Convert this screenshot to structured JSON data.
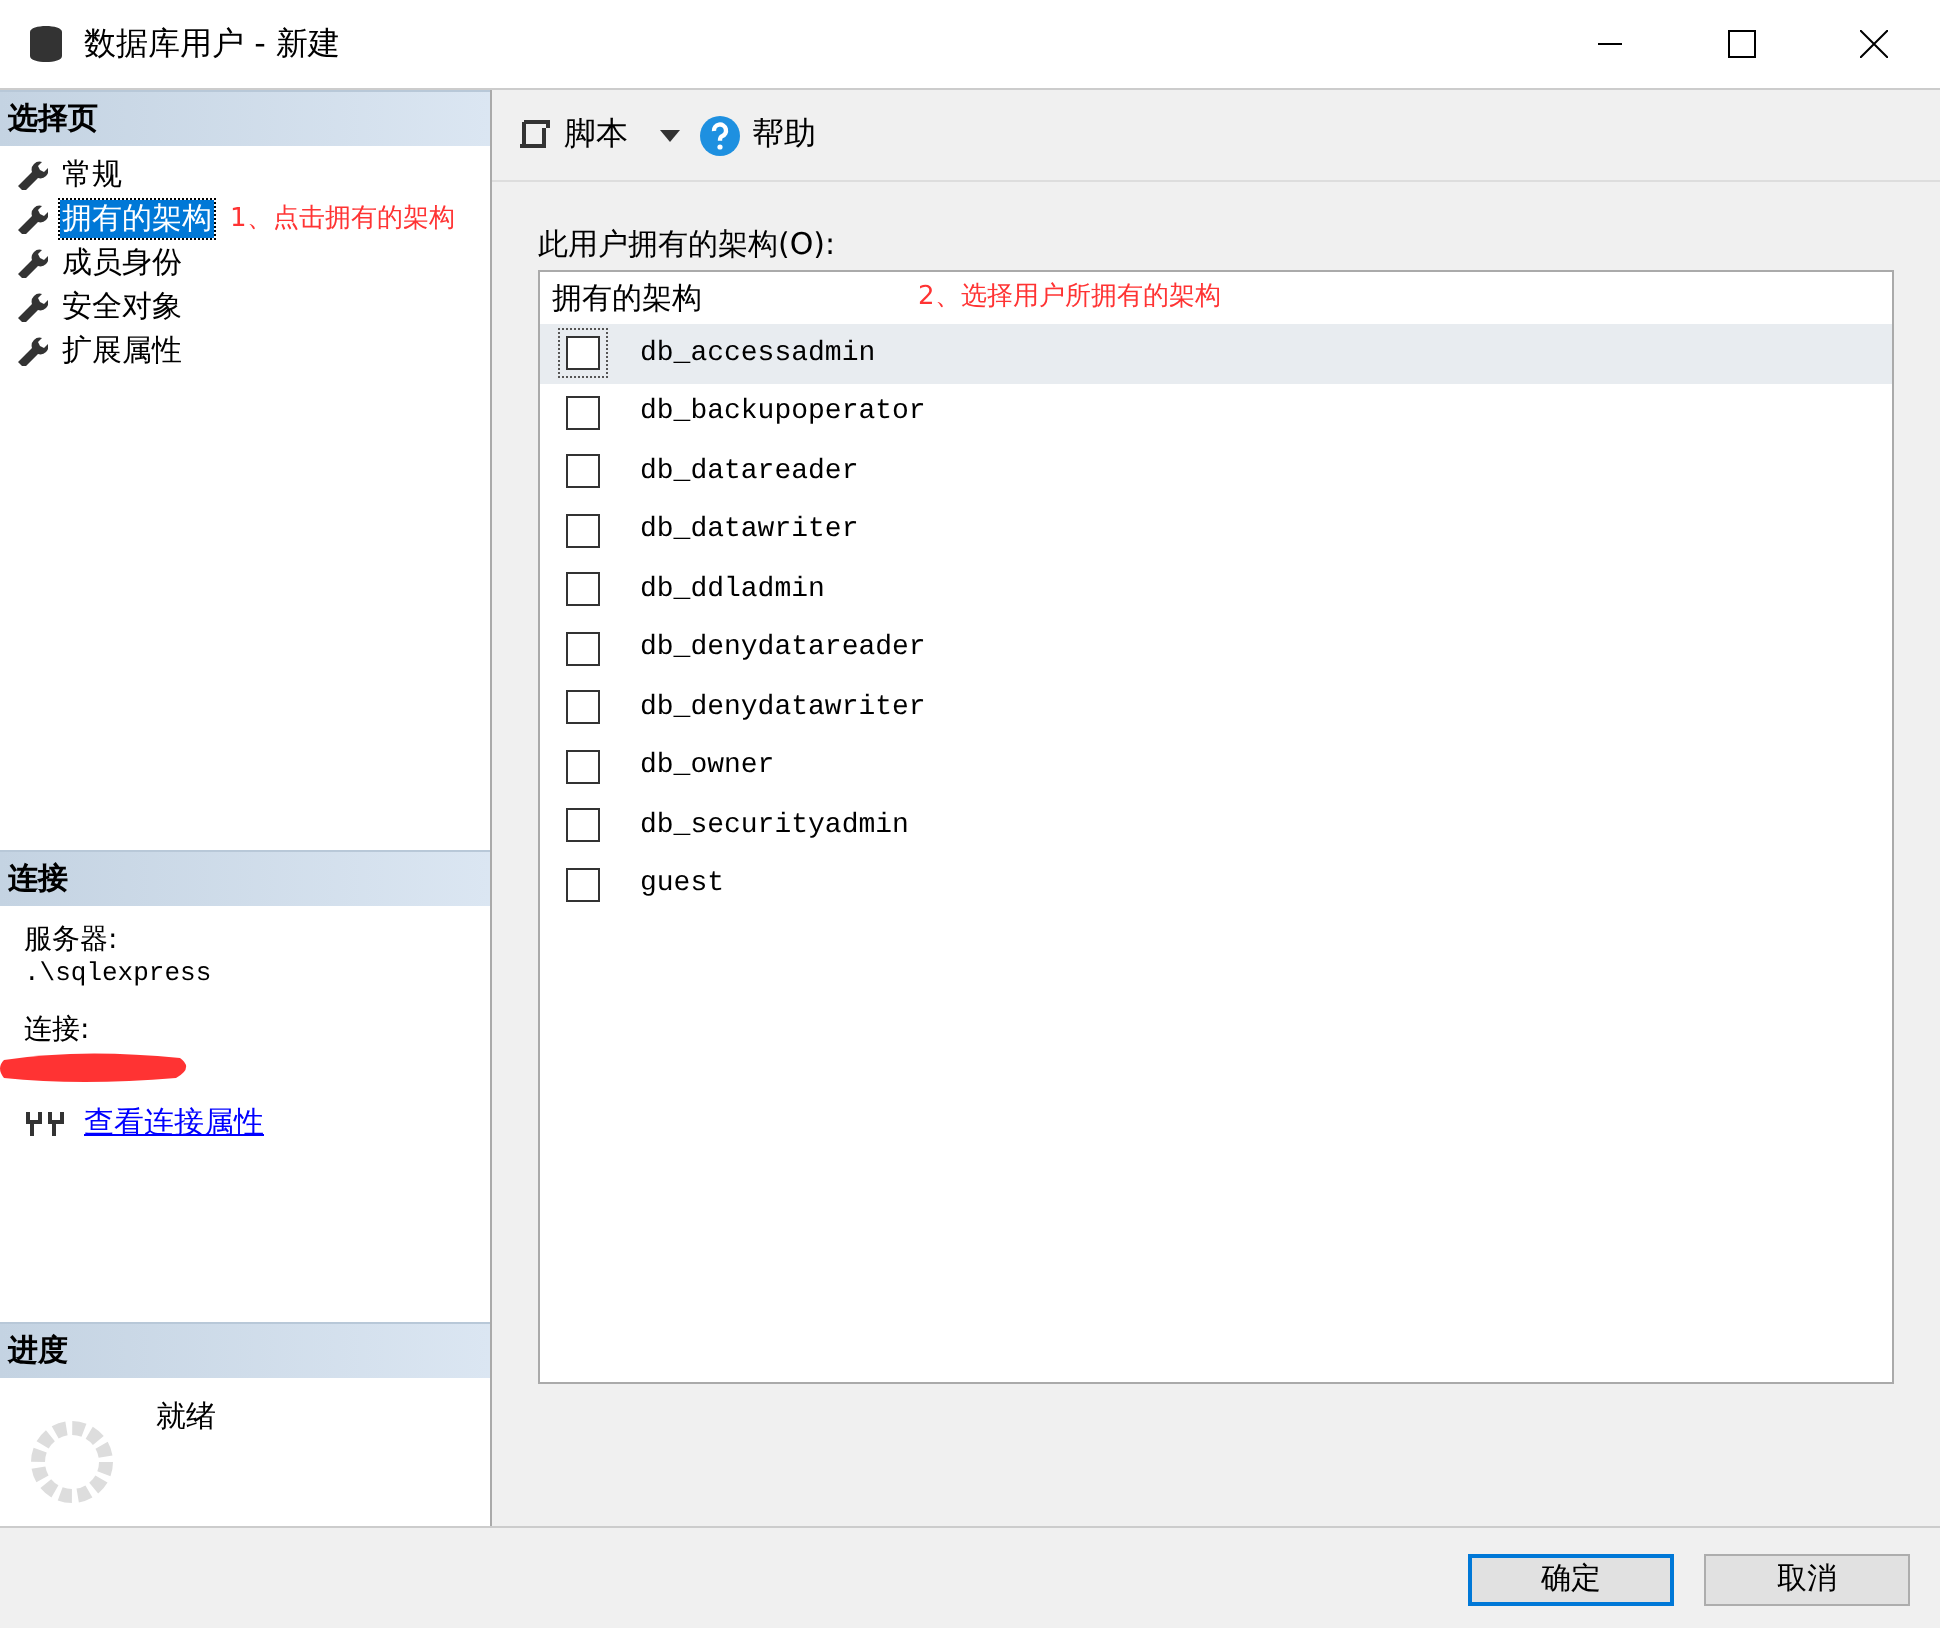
{
  "window": {
    "title": "数据库用户 - 新建"
  },
  "sidebar": {
    "header": "选择页",
    "pages": [
      {
        "label": "常规",
        "selected": false
      },
      {
        "label": "拥有的架构",
        "selected": true
      },
      {
        "label": "成员身份",
        "selected": false
      },
      {
        "label": "安全对象",
        "selected": false
      },
      {
        "label": "扩展属性",
        "selected": false
      }
    ],
    "annotation": "1、点击拥有的架构"
  },
  "connection": {
    "header": "连接",
    "server_label": "服务器:",
    "server": ".\\sqlexpress",
    "connection_label": "连接:",
    "link": "查看连接属性"
  },
  "progress": {
    "header": "进度",
    "status": "就绪"
  },
  "toolbar": {
    "script": "脚本",
    "help": "帮助"
  },
  "schemas": {
    "label": "此用户拥有的架构(O):",
    "column": "拥有的架构",
    "annotation": "2、选择用户所拥有的架构",
    "rows": [
      {
        "name": "db_accessadmin",
        "checked": false,
        "selected": true
      },
      {
        "name": "db_backupoperator",
        "checked": false,
        "selected": false
      },
      {
        "name": "db_datareader",
        "checked": false,
        "selected": false
      },
      {
        "name": "db_datawriter",
        "checked": false,
        "selected": false
      },
      {
        "name": "db_ddladmin",
        "checked": false,
        "selected": false
      },
      {
        "name": "db_denydatareader",
        "checked": false,
        "selected": false
      },
      {
        "name": "db_denydatawriter",
        "checked": false,
        "selected": false
      },
      {
        "name": "db_owner",
        "checked": false,
        "selected": false
      },
      {
        "name": "db_securityadmin",
        "checked": false,
        "selected": false
      },
      {
        "name": "guest",
        "checked": false,
        "selected": false
      }
    ]
  },
  "buttons": [
    {
      "label": "确定",
      "default": true
    },
    {
      "label": "取消",
      "default": false
    }
  ]
}
